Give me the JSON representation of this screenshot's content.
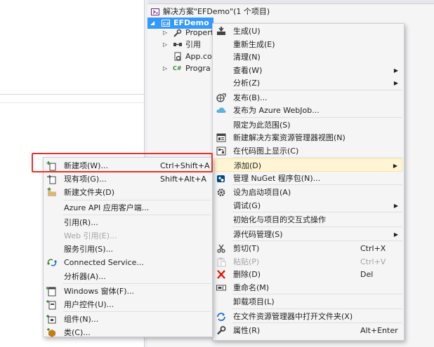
{
  "solution_explorer": {
    "solution_label": "解决方案\"EFDemo\"(1 个项目)",
    "project_label": "EFDemo",
    "nodes": [
      {
        "label": "Propert",
        "icon": "properties-icon",
        "expandable": true
      },
      {
        "label": "引用",
        "icon": "references-icon",
        "expandable": true
      },
      {
        "label": "App.co",
        "icon": "config-file-icon",
        "expandable": false
      },
      {
        "label": "Progra",
        "icon": "csharp-file-icon",
        "expandable": true,
        "icon_text": "C#"
      }
    ]
  },
  "project_menu": {
    "items": [
      {
        "label": "生成(U)",
        "icon": "build-icon",
        "shortcut": "",
        "submenu": false,
        "disabled": false,
        "highlighted": false,
        "sep_after": false
      },
      {
        "label": "重新生成(E)",
        "icon": "",
        "shortcut": "",
        "submenu": false,
        "disabled": false,
        "highlighted": false,
        "sep_after": false
      },
      {
        "label": "清理(N)",
        "icon": "",
        "shortcut": "",
        "submenu": false,
        "disabled": false,
        "highlighted": false,
        "sep_after": false
      },
      {
        "label": "查看(W)",
        "icon": "",
        "shortcut": "",
        "submenu": true,
        "disabled": false,
        "highlighted": false,
        "sep_after": false
      },
      {
        "label": "分析(Z)",
        "icon": "",
        "shortcut": "",
        "submenu": true,
        "disabled": false,
        "highlighted": false,
        "sep_after": true
      },
      {
        "label": "发布(B)...",
        "icon": "publish-icon",
        "shortcut": "",
        "submenu": false,
        "disabled": false,
        "highlighted": false,
        "sep_after": false
      },
      {
        "label": "发布为 Azure WebJob...",
        "icon": "cloud-icon",
        "shortcut": "",
        "submenu": false,
        "disabled": false,
        "highlighted": false,
        "sep_after": true
      },
      {
        "label": "限定为此范围(S)",
        "icon": "",
        "shortcut": "",
        "submenu": false,
        "disabled": false,
        "highlighted": false,
        "sep_after": false
      },
      {
        "label": "新建解决方案资源管理器视图(N)",
        "icon": "new-view-icon",
        "shortcut": "",
        "submenu": false,
        "disabled": false,
        "highlighted": false,
        "sep_after": false
      },
      {
        "label": "在代码图上显示(C)",
        "icon": "code-map-icon",
        "shortcut": "",
        "submenu": false,
        "disabled": false,
        "highlighted": false,
        "sep_after": true
      },
      {
        "label": "添加(D)",
        "icon": "",
        "shortcut": "",
        "submenu": true,
        "disabled": false,
        "highlighted": true,
        "sep_after": false
      },
      {
        "label": "管理 NuGet 程序包(N)...",
        "icon": "nuget-icon",
        "shortcut": "",
        "submenu": false,
        "disabled": false,
        "highlighted": false,
        "sep_after": true
      },
      {
        "label": "设为启动项目(A)",
        "icon": "startup-gear-icon",
        "shortcut": "",
        "submenu": false,
        "disabled": false,
        "highlighted": false,
        "sep_after": false
      },
      {
        "label": "调试(G)",
        "icon": "",
        "shortcut": "",
        "submenu": true,
        "disabled": false,
        "highlighted": false,
        "sep_after": true
      },
      {
        "label": "初始化与项目的交互式操作",
        "icon": "",
        "shortcut": "",
        "submenu": false,
        "disabled": false,
        "highlighted": false,
        "sep_after": true
      },
      {
        "label": "源代码管理(S)",
        "icon": "",
        "shortcut": "",
        "submenu": true,
        "disabled": false,
        "highlighted": false,
        "sep_after": true
      },
      {
        "label": "剪切(T)",
        "icon": "scissors-icon",
        "shortcut": "Ctrl+X",
        "submenu": false,
        "disabled": false,
        "highlighted": false,
        "sep_after": false
      },
      {
        "label": "粘贴(P)",
        "icon": "paste-icon",
        "shortcut": "Ctrl+V",
        "submenu": false,
        "disabled": true,
        "highlighted": false,
        "sep_after": false
      },
      {
        "label": "删除(D)",
        "icon": "delete-x-icon",
        "shortcut": "Del",
        "submenu": false,
        "disabled": false,
        "highlighted": false,
        "sep_after": false
      },
      {
        "label": "重命名(M)",
        "icon": "rename-icon",
        "shortcut": "",
        "submenu": false,
        "disabled": false,
        "highlighted": false,
        "sep_after": true
      },
      {
        "label": "卸载项目(L)",
        "icon": "",
        "shortcut": "",
        "submenu": false,
        "disabled": false,
        "highlighted": false,
        "sep_after": true
      },
      {
        "label": "在文件资源管理器中打开文件夹(X)",
        "icon": "refresh-folder-icon",
        "shortcut": "",
        "submenu": false,
        "disabled": false,
        "highlighted": false,
        "sep_after": true
      },
      {
        "label": "属性(R)",
        "icon": "wrench-icon",
        "shortcut": "Alt+Enter",
        "submenu": false,
        "disabled": false,
        "highlighted": false,
        "sep_after": false
      }
    ]
  },
  "add_submenu": {
    "items": [
      {
        "label": "新建项(W)...",
        "icon": "new-item-icon",
        "shortcut": "Ctrl+Shift+A",
        "disabled": false,
        "sep_after": false
      },
      {
        "label": "现有项(G)...",
        "icon": "existing-item-icon",
        "shortcut": "Shift+Alt+A",
        "disabled": false,
        "sep_after": false
      },
      {
        "label": "新建文件夹(D)",
        "icon": "new-folder-icon",
        "shortcut": "",
        "disabled": false,
        "sep_after": true
      },
      {
        "label": "Azure API 应用客户端...",
        "icon": "",
        "shortcut": "",
        "disabled": false,
        "sep_after": true
      },
      {
        "label": "引用(R)...",
        "icon": "",
        "shortcut": "",
        "disabled": false,
        "sep_after": false
      },
      {
        "label": "Web 引用(E)...",
        "icon": "",
        "shortcut": "",
        "disabled": true,
        "sep_after": false
      },
      {
        "label": "服务引用(S)...",
        "icon": "",
        "shortcut": "",
        "disabled": false,
        "sep_after": false
      },
      {
        "label": "Connected Service...",
        "icon": "connected-service-icon",
        "shortcut": "",
        "disabled": false,
        "sep_after": false
      },
      {
        "label": "分析器(A)...",
        "icon": "",
        "shortcut": "",
        "disabled": false,
        "sep_after": true
      },
      {
        "label": "Windows 窗体(F)...",
        "icon": "windows-form-icon",
        "shortcut": "",
        "disabled": false,
        "sep_after": false
      },
      {
        "label": "用户控件(U)...",
        "icon": "user-control-icon",
        "shortcut": "",
        "disabled": false,
        "sep_after": true
      },
      {
        "label": "组件(N)...",
        "icon": "component-icon",
        "shortcut": "",
        "disabled": false,
        "sep_after": false
      },
      {
        "label": "类(C)...",
        "icon": "class-icon",
        "shortcut": "",
        "disabled": false,
        "sep_after": false
      }
    ]
  },
  "colors": {
    "menu_background": "#f5f5f5",
    "menu_highlight": "#fff5d4",
    "selection_blue": "#3399ff",
    "callout_red": "#e5322d",
    "disabled_text": "#a2a4a5"
  }
}
